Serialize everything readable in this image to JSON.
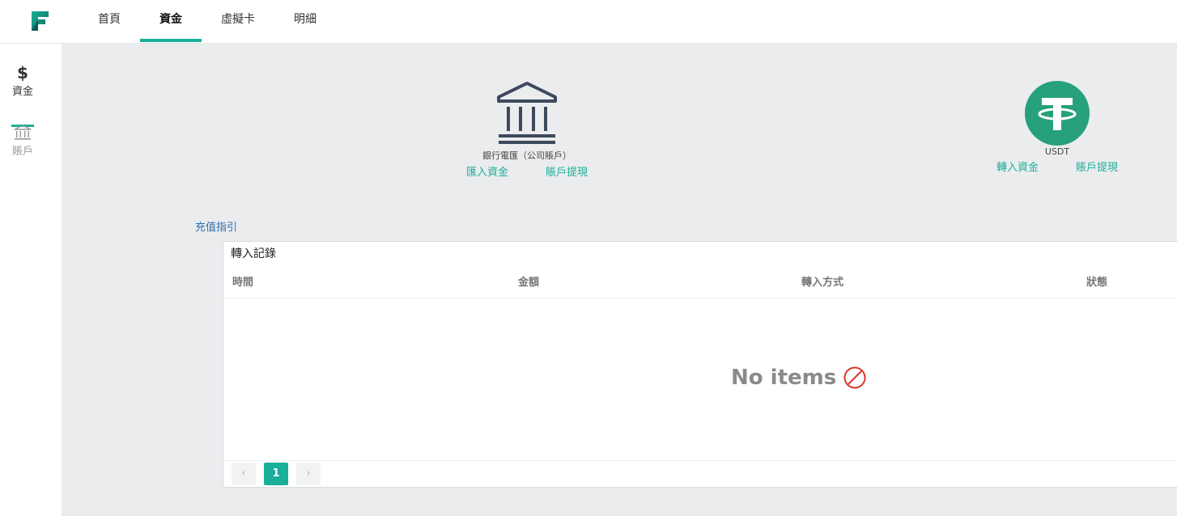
{
  "nav": {
    "tabs": [
      {
        "label": "首頁"
      },
      {
        "label": "資金"
      },
      {
        "label": "虛擬卡"
      },
      {
        "label": "明細"
      }
    ]
  },
  "sidebar": {
    "items": [
      {
        "icon": "dollar-icon",
        "glyph": "$",
        "label": "資金"
      },
      {
        "icon": "bank-icon",
        "label": "賬戶"
      }
    ]
  },
  "methods": {
    "bank": {
      "caption": "銀行電匯（公司賬戶）",
      "deposit": "匯入資金",
      "withdraw": "賬戶提現"
    },
    "usdt": {
      "caption": "USDT",
      "deposit": "轉入資金",
      "withdraw": "賬戶提現"
    }
  },
  "guide_link": "充值指引",
  "records": {
    "title": "轉入記錄",
    "columns": [
      "時間",
      "金額",
      "轉入方式",
      "狀態"
    ],
    "empty_text": "No items",
    "pagination": {
      "current": "1",
      "prev": "‹",
      "next": "›"
    }
  },
  "colors": {
    "accent": "#1aaf99",
    "tether": "#26a17b",
    "link": "#2a6fb0",
    "bank_icon": "#3d4a5c"
  }
}
